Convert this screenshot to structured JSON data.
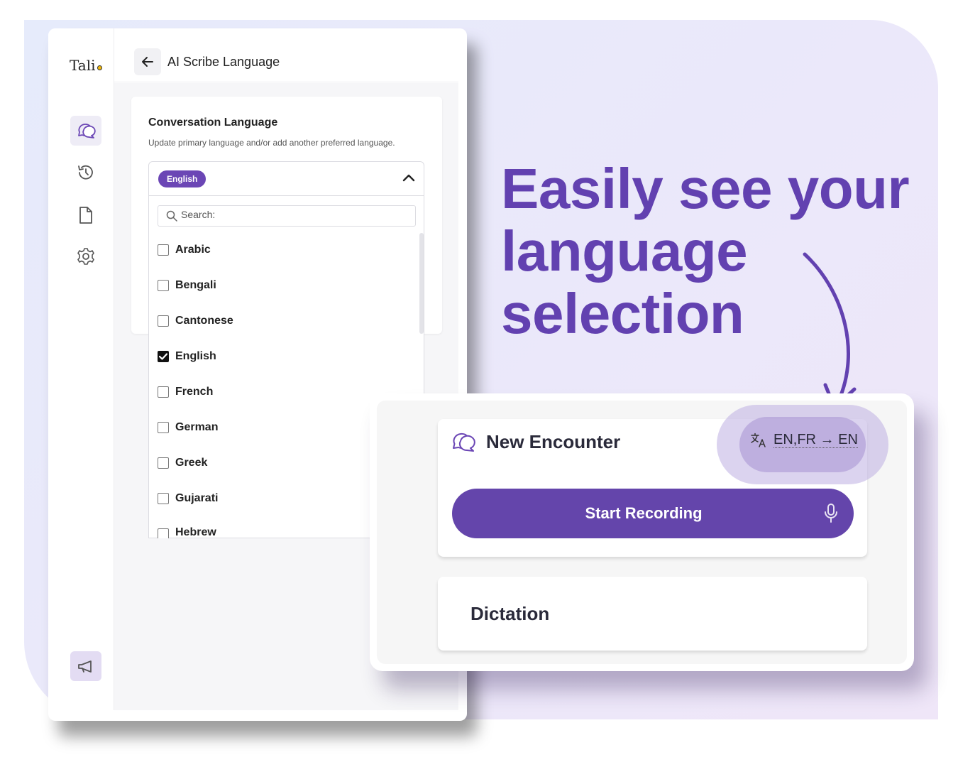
{
  "app": {
    "logo_text": "Tali",
    "page_title": "AI Scribe Language",
    "rail_icons": [
      "chat-icon",
      "history-icon",
      "document-icon",
      "settings-icon",
      "megaphone-icon"
    ]
  },
  "language_card": {
    "title": "Conversation Language",
    "subtitle": "Update primary language and/or add another preferred language.",
    "selected_pill": "English",
    "search_placeholder": "Search:",
    "options": [
      {
        "label": "Arabic",
        "checked": false
      },
      {
        "label": "Bengali",
        "checked": false
      },
      {
        "label": "Cantonese",
        "checked": false
      },
      {
        "label": "English",
        "checked": true
      },
      {
        "label": "French",
        "checked": false
      },
      {
        "label": "German",
        "checked": false
      },
      {
        "label": "Greek",
        "checked": false
      },
      {
        "label": "Gujarati",
        "checked": false
      },
      {
        "label": "Hebrew",
        "checked": false
      }
    ]
  },
  "headline": {
    "line1": "Easily see your",
    "line2": "language",
    "line3": "selection"
  },
  "encounter": {
    "title": "New Encounter",
    "language_indicator": "EN,FR → EN",
    "record_button": "Start Recording",
    "dictation_label": "Dictation"
  },
  "colors": {
    "accent": "#6445ab",
    "headline": "#6241b0",
    "pill": "#6b46b5",
    "logo_dot": "#f2b90c"
  }
}
